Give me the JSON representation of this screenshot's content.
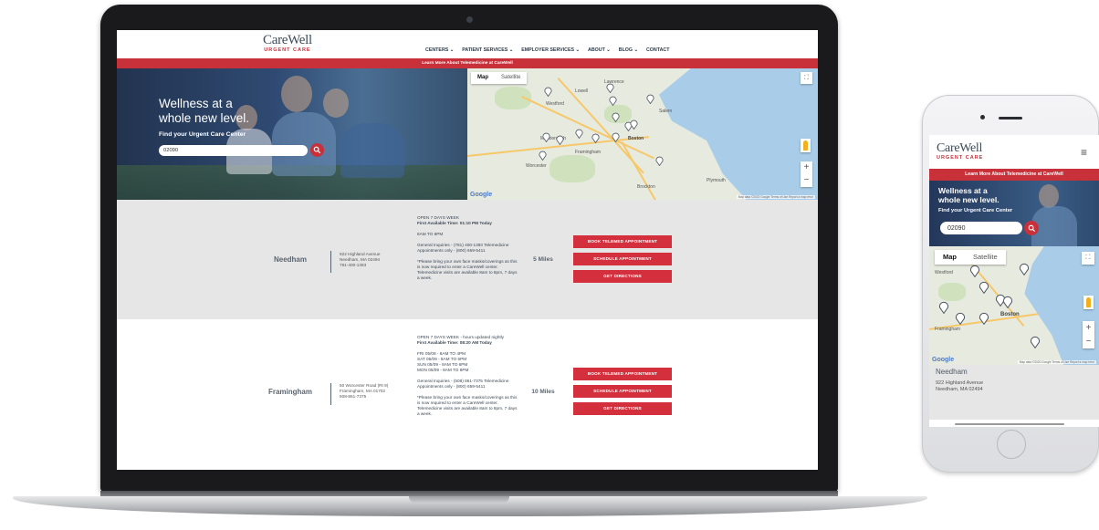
{
  "brand": {
    "name": "CareWell",
    "tagline": "URGENT CARE",
    "red": "#c8303a",
    "navy": "#2d3a47"
  },
  "nav": [
    "CENTERS ⌄",
    "PATIENT SERVICES ⌄",
    "EMPLOYER SERVICES ⌄",
    "ABOUT ⌄",
    "BLOG ⌄",
    "CONTACT"
  ],
  "promo": "Learn More About Telemedicine at CareWell",
  "hero": {
    "title_line1": "Wellness at a",
    "title_line2": "whole new level.",
    "subtitle": "Find your Urgent Care Center",
    "zip_value": "02090"
  },
  "map": {
    "tab_map": "Map",
    "tab_satellite": "Satellite",
    "google": "Google",
    "terms": "Map data ©2020 Google   Terms of Use   Report a map error",
    "zoom_in": "+",
    "zoom_out": "−",
    "labels": {
      "boston": "Boston",
      "framingham": "Framingham",
      "worcester": "Worcester",
      "brockton": "Brockton",
      "lowell": "Lowell",
      "lawrence": "Lawrence",
      "salem": "Salem",
      "westford": "Westford",
      "marlborough": "Marlborough",
      "plymouth": "Plymouth"
    }
  },
  "locations": [
    {
      "name": "Needham",
      "address1": "922 Highland Avenue",
      "address2": "Needham, MA 02494",
      "phone": "781-400-1383",
      "hours_title": "OPEN 7 DAYS WEEK",
      "first_available": "First Available Time: 01:10 PM Today",
      "hours": "8AM TO 8PM",
      "inquiries": "General Inquiries - (781) 400-1383 Telemedicine Appointments only - (800) 659-5411",
      "note": "*Please bring your own face masks/coverings as this is now required to enter a CareWell center. Telemedicine visits are available 8am to 8pm, 7 days a week.",
      "distance": "5 Miles"
    },
    {
      "name": "Framingham",
      "address1": "50 Worcester Road (Rt 9)",
      "address2": "Framingham, MA 01702",
      "phone": "508-861-7375",
      "hours_title": "OPEN 7 DAYS WEEK - hours updated nightly",
      "first_available": "First Available Time: 08:20 AM Today",
      "hours_fri": "FRI 05/08 - 8AM TO 4PM",
      "hours_sat": "SAT 05/09 - 8AM TO 6PM",
      "hours_sun": "SUN 05/09 - 8AM TO 6PM",
      "hours_mon": "MON 05/09 - 8AM TO 8PM",
      "inquiries": "General Inquiries - (508) 861-7375 Telemedicine Appointments only - (800) 659-5411",
      "note": "*Please bring your own face masks/coverings as this is now required to enter a CareWell center. Telemedicine visits are available 8am to 8pm, 7 days a week.",
      "distance": "10 Miles"
    }
  ],
  "buttons": {
    "telemed": "BOOK TELEMED APPOINTMENT",
    "schedule": "SCHEDULE APPOINTMENT",
    "directions": "GET DIRECTIONS"
  },
  "mobile": {
    "menu_icon": "≡",
    "title_line1": "Wellness at a",
    "title_line2": "whole new level.",
    "loc_name": "Needham",
    "loc_addr1": "922 Highland Avenue",
    "loc_addr2": "Needham, MA 02494"
  }
}
